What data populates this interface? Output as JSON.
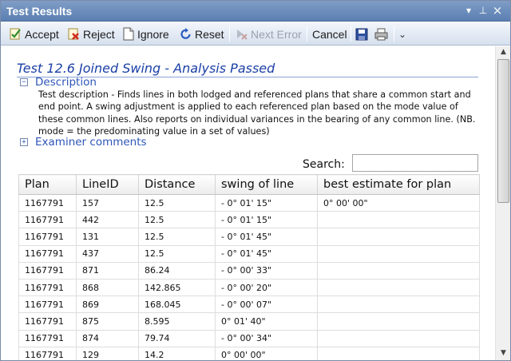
{
  "window": {
    "title": "Test Results"
  },
  "title_controls": {
    "dropdown": "▾",
    "pin": "⊥",
    "close": "×"
  },
  "toolbar": {
    "accept": "Accept",
    "reject": "Reject",
    "ignore": "Ignore",
    "reset": "Reset",
    "next_error": "Next Error",
    "cancel": "Cancel",
    "overflow": "⌄"
  },
  "test": {
    "title": "Test 12.6 Joined Swing - Analysis Passed",
    "description_header": "Description",
    "description_text": "Test description - Finds lines in both lodged and referenced plans that share a common start and end point. A swing adjustment is applied to each referenced plan based on the mode value of these common lines. Also reports on individual variances in the bearing of any common line. (NB. mode = the predominating value in a set of values)",
    "examiner_header": "Examiner comments",
    "collapse_glyph": "−",
    "expand_glyph": "+"
  },
  "search": {
    "label": "Search:",
    "value": ""
  },
  "table": {
    "columns": [
      "Plan",
      "LineID",
      "Distance",
      "swing of line",
      "best estimate for plan"
    ],
    "rows": [
      [
        "1167791",
        "157",
        "12.5",
        "- 0° 01' 15\"",
        "0° 00' 00\""
      ],
      [
        "1167791",
        "442",
        "12.5",
        "- 0° 01' 15\"",
        ""
      ],
      [
        "1167791",
        "131",
        "12.5",
        "- 0° 01' 45\"",
        ""
      ],
      [
        "1167791",
        "437",
        "12.5",
        "- 0° 01' 45\"",
        ""
      ],
      [
        "1167791",
        "871",
        "86.24",
        "- 0° 00' 33\"",
        ""
      ],
      [
        "1167791",
        "868",
        "142.865",
        "- 0° 00' 20\"",
        ""
      ],
      [
        "1167791",
        "869",
        "168.045",
        "- 0° 00' 07\"",
        ""
      ],
      [
        "1167791",
        "875",
        "8.595",
        "0° 01' 40\"",
        ""
      ],
      [
        "1167791",
        "874",
        "79.74",
        "- 0° 00' 34\"",
        ""
      ],
      [
        "1167791",
        "129",
        "14.2",
        "0° 00' 00\"",
        ""
      ]
    ]
  },
  "scrollbar": {
    "up": "▲",
    "down": "▼"
  }
}
